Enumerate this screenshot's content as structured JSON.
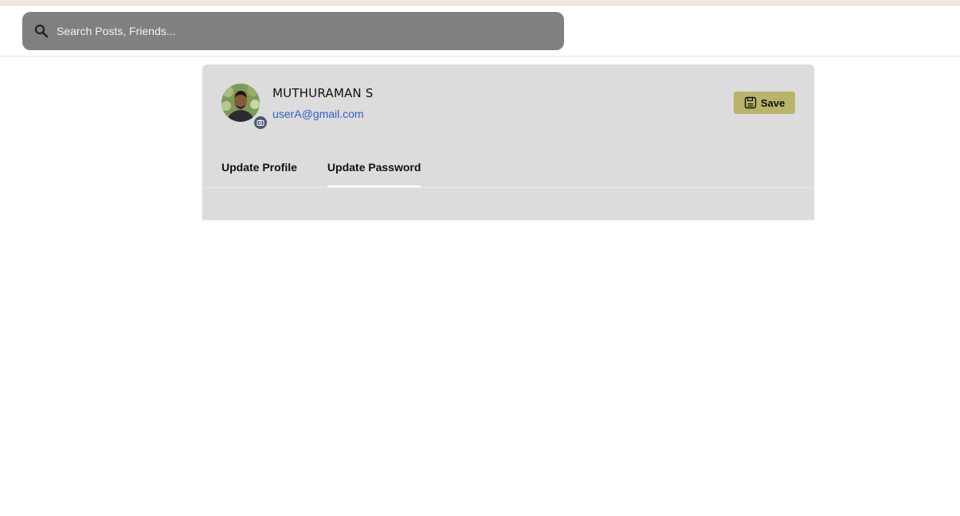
{
  "search": {
    "placeholder": "Search Posts, Friends..."
  },
  "profile": {
    "name": "MUTHURAMAN S",
    "email": "userA@gmail.com"
  },
  "actions": {
    "save_label": "Save"
  },
  "tabs": [
    {
      "label": "Update Profile",
      "active": false
    },
    {
      "label": "Update Password",
      "active": true
    }
  ],
  "colors": {
    "card_bg": "#dcdcdc",
    "search_bg": "#808080",
    "save_bg": "#b8b46a",
    "email": "#2f5ec9"
  }
}
